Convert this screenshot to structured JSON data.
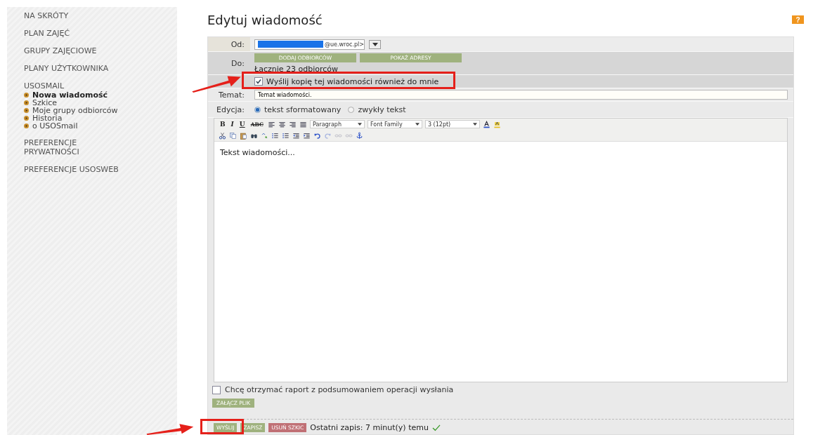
{
  "sidebar": {
    "items": [
      {
        "label": "NA SKRÓTY"
      },
      {
        "label": "PLAN ZAJĘĆ"
      },
      {
        "label": "GRUPY ZAJĘCIOWE"
      },
      {
        "label": "PLANY UŻYTKOWNIKA"
      },
      {
        "label": "USOSMAIL",
        "children": [
          {
            "label": "Nowa wiadomość",
            "selected": true
          },
          {
            "label": "Szkice",
            "selected": false
          },
          {
            "label": "Moje grupy odbiorców",
            "selected": false
          },
          {
            "label": "Historia",
            "selected": false
          },
          {
            "label": "o USOSmail",
            "selected": false
          }
        ]
      },
      {
        "label": "PREFERENCJE PRYWATNOŚCI"
      },
      {
        "label": "PREFERENCJE USOSWEB"
      }
    ]
  },
  "page": {
    "title": "Edytuj wiadomość",
    "help": "?"
  },
  "form": {
    "from": {
      "label": "Od:",
      "value": "@ue.wroc.pl>"
    },
    "to": {
      "label": "Do:",
      "buttons": [
        "DODAJ ODBIORCÓW",
        "POKAŻ ADRESY"
      ],
      "summary": "Łącznie 23 odbiorców",
      "copy_to_me": {
        "label": "Wyślij kopię tej wiadomości również do mnie",
        "checked": true
      }
    },
    "subject": {
      "label": "Temat:",
      "value": "Temat wiadomości."
    },
    "edit_mode": {
      "label": "Edycja:",
      "options": [
        {
          "label": "tekst sformatowany",
          "selected": true
        },
        {
          "label": "zwykły tekst",
          "selected": false
        }
      ]
    }
  },
  "editor": {
    "toolbar_row_1": [
      {
        "kind": "text",
        "label": "B"
      },
      {
        "kind": "text",
        "label": "I"
      },
      {
        "kind": "text",
        "label": "U"
      },
      {
        "kind": "text",
        "label": "ABC"
      },
      {
        "kind": "icon"
      },
      {
        "kind": "icon"
      },
      {
        "kind": "icon"
      },
      {
        "kind": "icon"
      },
      {
        "kind": "select",
        "label": "Paragraph"
      },
      {
        "kind": "select",
        "label": "Font Family"
      },
      {
        "kind": "select",
        "label": "3 (12pt)"
      },
      {
        "kind": "icon"
      },
      {
        "kind": "icon"
      }
    ],
    "body": "Tekst wiadomości..."
  },
  "report": {
    "label": "Chcę otrzymać raport z podsumowaniem operacji wysłania",
    "checked": false
  },
  "attach_button": "ZAŁĄCZ PLIK",
  "actions": [
    {
      "label": "WYŚLIJ",
      "kind": "primary"
    },
    {
      "label": "ZAPISZ",
      "kind": "primary"
    },
    {
      "label": "USUŃ SZKIC",
      "kind": "danger"
    }
  ],
  "last_saved": "Ostatni zapis: 7 minut(y) temu"
}
